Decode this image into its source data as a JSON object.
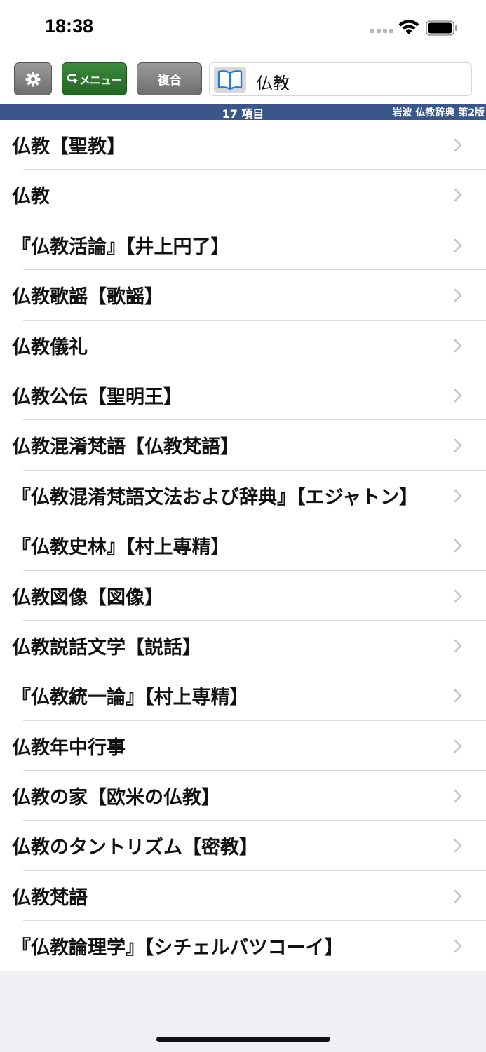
{
  "status_bar": {
    "time": "18:38",
    "icons": [
      "signal-dots-icon",
      "wifi-icon",
      "battery-icon"
    ]
  },
  "toolbar": {
    "settings_icon": "gear-icon",
    "menu_label": "メニュー",
    "menu_icon": "return-arrow-icon",
    "compound_label": "複合",
    "book_icon": "open-book-icon",
    "search_value": "仏教"
  },
  "info_bar": {
    "count": "17 項目",
    "dictionary": "岩波 仏教辞典 第2版"
  },
  "results": [
    {
      "label": "仏教【聖教】"
    },
    {
      "label": "仏教"
    },
    {
      "label": "『仏教活論』【井上円了】"
    },
    {
      "label": "仏教歌謡【歌謡】"
    },
    {
      "label": "仏教儀礼"
    },
    {
      "label": "仏教公伝【聖明王】"
    },
    {
      "label": "仏教混淆梵語【仏教梵語】"
    },
    {
      "label": "『仏教混淆梵語文法および辞典』【エジャトン】"
    },
    {
      "label": "『仏教史林』【村上専精】"
    },
    {
      "label": "仏教図像【図像】"
    },
    {
      "label": "仏教説話文学【説話】"
    },
    {
      "label": "『仏教統一論』【村上専精】"
    },
    {
      "label": "仏教年中行事"
    },
    {
      "label": "仏教の家【欧米の仏教】"
    },
    {
      "label": "仏教のタントリズム【密教】"
    },
    {
      "label": "仏教梵語"
    },
    {
      "label": "『仏教論理学』【シチェルバツコーイ】"
    }
  ],
  "colors": {
    "info_bar_bg": "#3b5689",
    "menu_button_bg": "#2f7a2f",
    "gray_button_bg": "#808080"
  }
}
